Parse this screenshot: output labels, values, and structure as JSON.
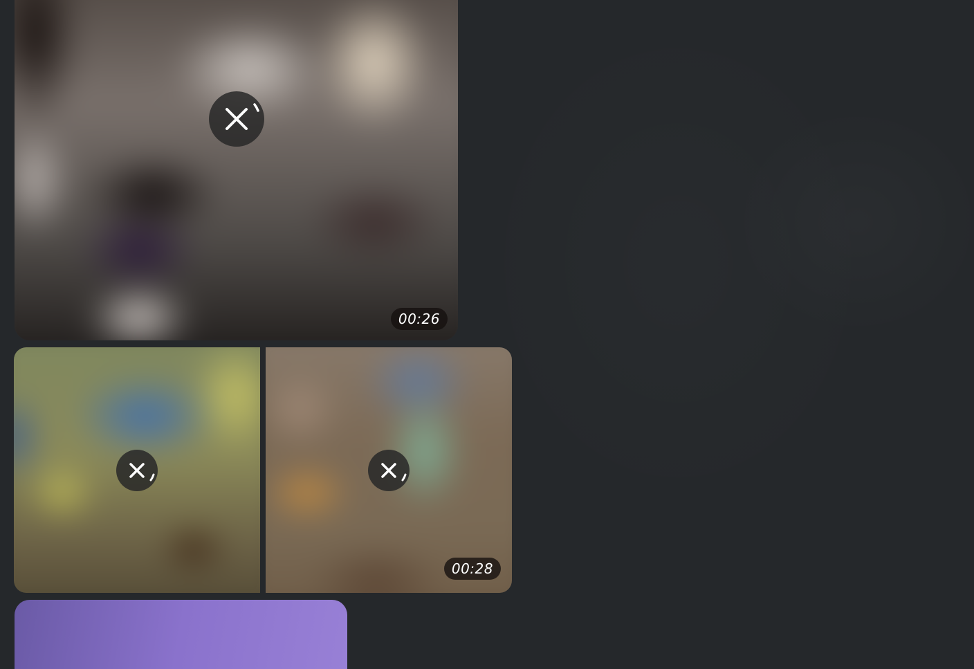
{
  "chat": {
    "background_color": "#25282b"
  },
  "album": {
    "items": [
      {
        "kind": "video",
        "duration": "00:26",
        "cancel_icon": "close-icon",
        "state": "uploading"
      },
      {
        "kind": "photo",
        "cancel_icon": "close-icon",
        "state": "uploading"
      },
      {
        "kind": "video",
        "duration": "00:28",
        "cancel_icon": "close-icon",
        "state": "uploading"
      },
      {
        "kind": "photo",
        "state": "uploading"
      }
    ]
  }
}
